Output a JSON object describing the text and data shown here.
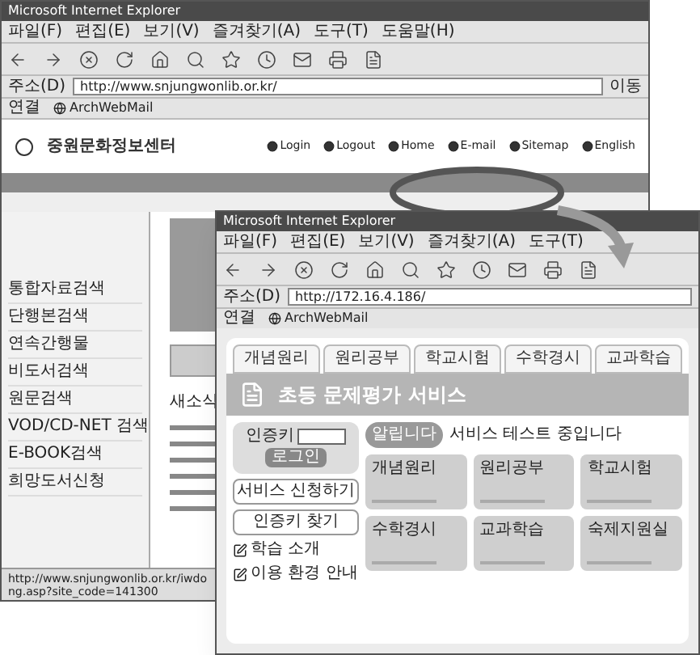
{
  "back_window": {
    "title": "Microsoft Internet Explorer",
    "menu": [
      "파일(F)",
      "편집(E)",
      "보기(V)",
      "즐겨찾기(A)",
      "도구(T)",
      "도움말(H)"
    ],
    "address_label": "주소(D)",
    "address": "http://www.snjungwonlib.or.kr/",
    "go": "이동",
    "links_label": "연결",
    "links": [
      "ArchWebMail"
    ],
    "site_name": "중원문화정보센터",
    "top_links": [
      "Login",
      "Logout",
      "Home",
      "E-mail",
      "Sitemap",
      "English"
    ],
    "sidebar": [
      "통합자료검색",
      "단행본검색",
      "연속간행물",
      "비도서검색",
      "원문검색",
      "VOD/CD-NET 검색",
      "E-BOOK검색",
      "희망도서신청"
    ],
    "news_title": "새소식",
    "status": "http://www.snjungwonlib.or.kr/iwdong.asp?site_code=141300"
  },
  "front_window": {
    "title": "Microsoft Internet Explorer",
    "menu": [
      "파일(F)",
      "편집(E)",
      "보기(V)",
      "즐겨찾기(A)",
      "도구(T)"
    ],
    "address_label": "주소(D)",
    "address": "http://172.16.4.186/",
    "links_label": "연결",
    "links": [
      "ArchWebMail"
    ],
    "tabs": [
      {
        "label": "개념원리",
        "selected": false
      },
      {
        "label": "원리공부",
        "selected": false
      },
      {
        "label": "학교시험",
        "selected": false
      },
      {
        "label": "수학경시",
        "selected": false
      },
      {
        "label": "교과학습",
        "selected": false
      }
    ],
    "banner": "초등 문제평가 서비스",
    "login": {
      "label": "인증키",
      "button": "로그인"
    },
    "side_buttons": [
      "서비스 신청하기",
      "인증키 찾기"
    ],
    "side_links": [
      "학습 소개",
      "이용 환경 안내"
    ],
    "notice_badge": "알립니다",
    "notice": "서비스 테스트 중입니다",
    "cards": [
      "개념원리",
      "원리공부",
      "학교시험",
      "수학경시",
      "교과학습",
      "숙제지원실"
    ]
  }
}
